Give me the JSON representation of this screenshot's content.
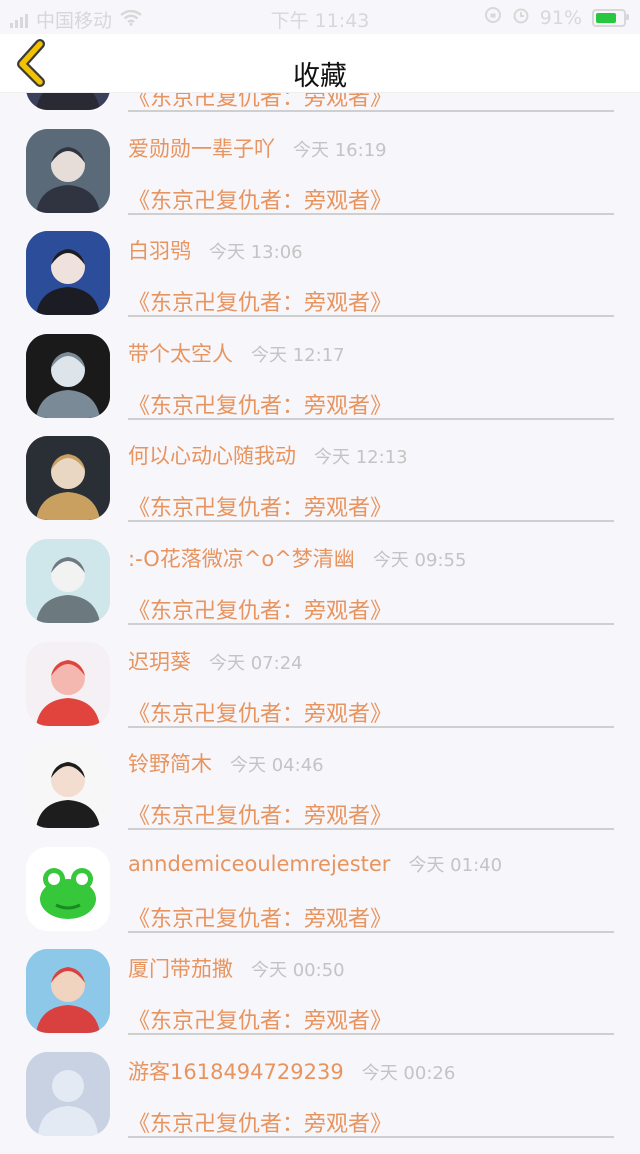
{
  "status_bar": {
    "carrier": "中国移动",
    "time": "下午 11:43",
    "battery": "91%",
    "battery_color": "#29c73f"
  },
  "nav": {
    "title": "收藏",
    "back_icon": "chevron-left-icon",
    "accent": "#f2c200"
  },
  "favorites": [
    {
      "user": "",
      "time": "",
      "title": "《东京卍复仇者：旁观者》"
    },
    {
      "user": "爱勋勋一辈子吖",
      "time": "今天 16:19",
      "title": "《东京卍复仇者：旁观者》"
    },
    {
      "user": "白羽鸮",
      "time": "今天 13:06",
      "title": "《东京卍复仇者：旁观者》"
    },
    {
      "user": "带个太空人",
      "time": "今天 12:17",
      "title": "《东京卍复仇者：旁观者》"
    },
    {
      "user": "何以心动心随我动",
      "time": "今天 12:13",
      "title": "《东京卍复仇者：旁观者》"
    },
    {
      "user": ":-O花落微凉^o^梦清幽",
      "time": "今天 09:55",
      "title": "《东京卍复仇者：旁观者》"
    },
    {
      "user": "迟玥葵",
      "time": "今天 07:24",
      "title": "《东京卍复仇者：旁观者》"
    },
    {
      "user": "铃野简木",
      "time": "今天 04:46",
      "title": "《东京卍复仇者：旁观者》"
    },
    {
      "user": "anndemiceoulemrejester",
      "time": "今天 01:40",
      "title": "《东京卍复仇者：旁观者》"
    },
    {
      "user": "厦门带茄撒",
      "time": "今天 00:50",
      "title": "《东京卍复仇者：旁观者》"
    },
    {
      "user": "游客1618494729239",
      "time": "今天 00:26",
      "title": "《东京卍复仇者：旁观者》"
    }
  ],
  "colors": {
    "username": "#e8945f",
    "timestamp": "#c4c4c4",
    "divider": "#cfcfcf"
  }
}
